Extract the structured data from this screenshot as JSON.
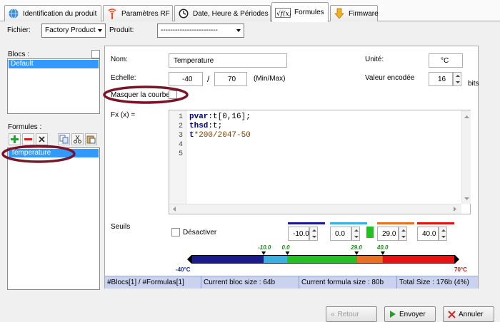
{
  "tabs": [
    {
      "label": "Identification du produit"
    },
    {
      "label": "Paramètres RF"
    },
    {
      "label": "Date, Heure & Périodes"
    },
    {
      "label": "Formules"
    },
    {
      "label": "Firmware"
    }
  ],
  "top": {
    "fichier_label": "Fichier:",
    "fichier_value": "Factory Product",
    "produit_label": "Produit:",
    "produit_value": "------------------------"
  },
  "blocs": {
    "label": "Blocs :",
    "items": [
      "Default"
    ]
  },
  "formules": {
    "label": "Formules :",
    "items": [
      "Temperature"
    ]
  },
  "form": {
    "nom_label": "Nom:",
    "nom_value": "Temperature",
    "unite_label": "Unité:",
    "unite_value": "°C",
    "echelle_label": "Echelle:",
    "min_value": "-40",
    "slash": "/",
    "max_value": "70",
    "minmax_label": "(Min/Max)",
    "valeur_label": "Valeur encodée",
    "bits_value": "16",
    "bits_label": "bits",
    "masquer_label": "Masquer la courbe",
    "fx_label": "Fx (x) =",
    "code_lines": [
      {
        "n": "1",
        "a": "pvar",
        "b": ":t[0,16];"
      },
      {
        "n": "2",
        "a": "thsd",
        "b": ":t;"
      },
      {
        "n": "3",
        "a": "t",
        "b": "*200/2047-50"
      },
      {
        "n": "4",
        "a": "",
        "b": ""
      },
      {
        "n": "5",
        "a": "",
        "b": ""
      }
    ]
  },
  "seuils": {
    "label": "Seuils",
    "desactiver_label": "Désactiver",
    "values": [
      "-10.0",
      "0.0",
      "29.0",
      "40.0"
    ],
    "swatch_colors": [
      "#1a1a8c",
      "#3ab0e0",
      "#e87020",
      "#e81010"
    ],
    "min_label": "-40°C",
    "max_label": "70°C",
    "markers": [
      "-10.0",
      "0.0",
      "29.0",
      "40.0"
    ]
  },
  "status": {
    "blocs": "#Blocs[1] / #Formulas[1]",
    "bloc_size": "Current bloc size : 64b",
    "formula_size": "Current formula size : 80b",
    "total": "Total Size : 176b (4%)"
  },
  "buttons": {
    "b1": "Retour",
    "b2": "Envoyer",
    "b3": "Annuler"
  }
}
